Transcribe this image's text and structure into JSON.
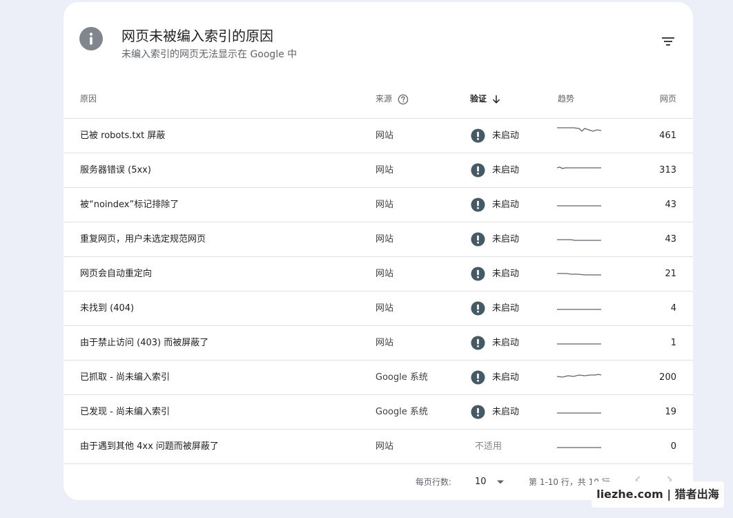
{
  "header": {
    "title": "网页未被编入索引的原因",
    "subtitle": "未编入索引的网页无法显示在 Google 中"
  },
  "columns": {
    "reason": "原因",
    "source": "来源",
    "validation": "验证",
    "trend": "趋势",
    "pages": "网页"
  },
  "rows": [
    {
      "reason": "已被 robots.txt 屏蔽",
      "source": "网站",
      "validation": "未启动",
      "pages": "461"
    },
    {
      "reason": "服务器错误 (5xx)",
      "source": "网站",
      "validation": "未启动",
      "pages": "313"
    },
    {
      "reason": "被“noindex”标记排除了",
      "source": "网站",
      "validation": "未启动",
      "pages": "43"
    },
    {
      "reason": "重复网页，用户未选定规范网页",
      "source": "网站",
      "validation": "未启动",
      "pages": "43"
    },
    {
      "reason": "网页会自动重定向",
      "source": "网站",
      "validation": "未启动",
      "pages": "21"
    },
    {
      "reason": "未找到 (404)",
      "source": "网站",
      "validation": "未启动",
      "pages": "4"
    },
    {
      "reason": "由于禁止访问 (403) 而被屏蔽了",
      "source": "网站",
      "validation": "未启动",
      "pages": "1"
    },
    {
      "reason": "已抓取 - 尚未编入索引",
      "source": "Google 系统",
      "validation": "未启动",
      "pages": "200"
    },
    {
      "reason": "已发现 - 尚未编入索引",
      "source": "Google 系统",
      "validation": "未启动",
      "pages": "19"
    },
    {
      "reason": "由于遇到其他 4xx 问题而被屏蔽了",
      "source": "网站",
      "validation": "不适用",
      "pages": "0"
    }
  ],
  "pagination": {
    "rows_per_page_label": "每页行数:",
    "rows_per_page": "10",
    "range_text": "第 1-10 行，共 10 行"
  },
  "watermark": "liezhe.com | 猎者出海",
  "colors": {
    "background": "#eceff7",
    "card": "#ffffff",
    "warning_icon": "#455a64",
    "sparkline": "#5f6368"
  },
  "icons": {
    "header": "info-icon",
    "filter": "filter-icon",
    "source_help": "help-circle-icon",
    "sort": "arrow-down-icon",
    "validation_status": "exclamation-circle-icon",
    "page_size": "caret-down-icon",
    "prev": "chevron-left-icon",
    "next": "chevron-right-icon"
  }
}
